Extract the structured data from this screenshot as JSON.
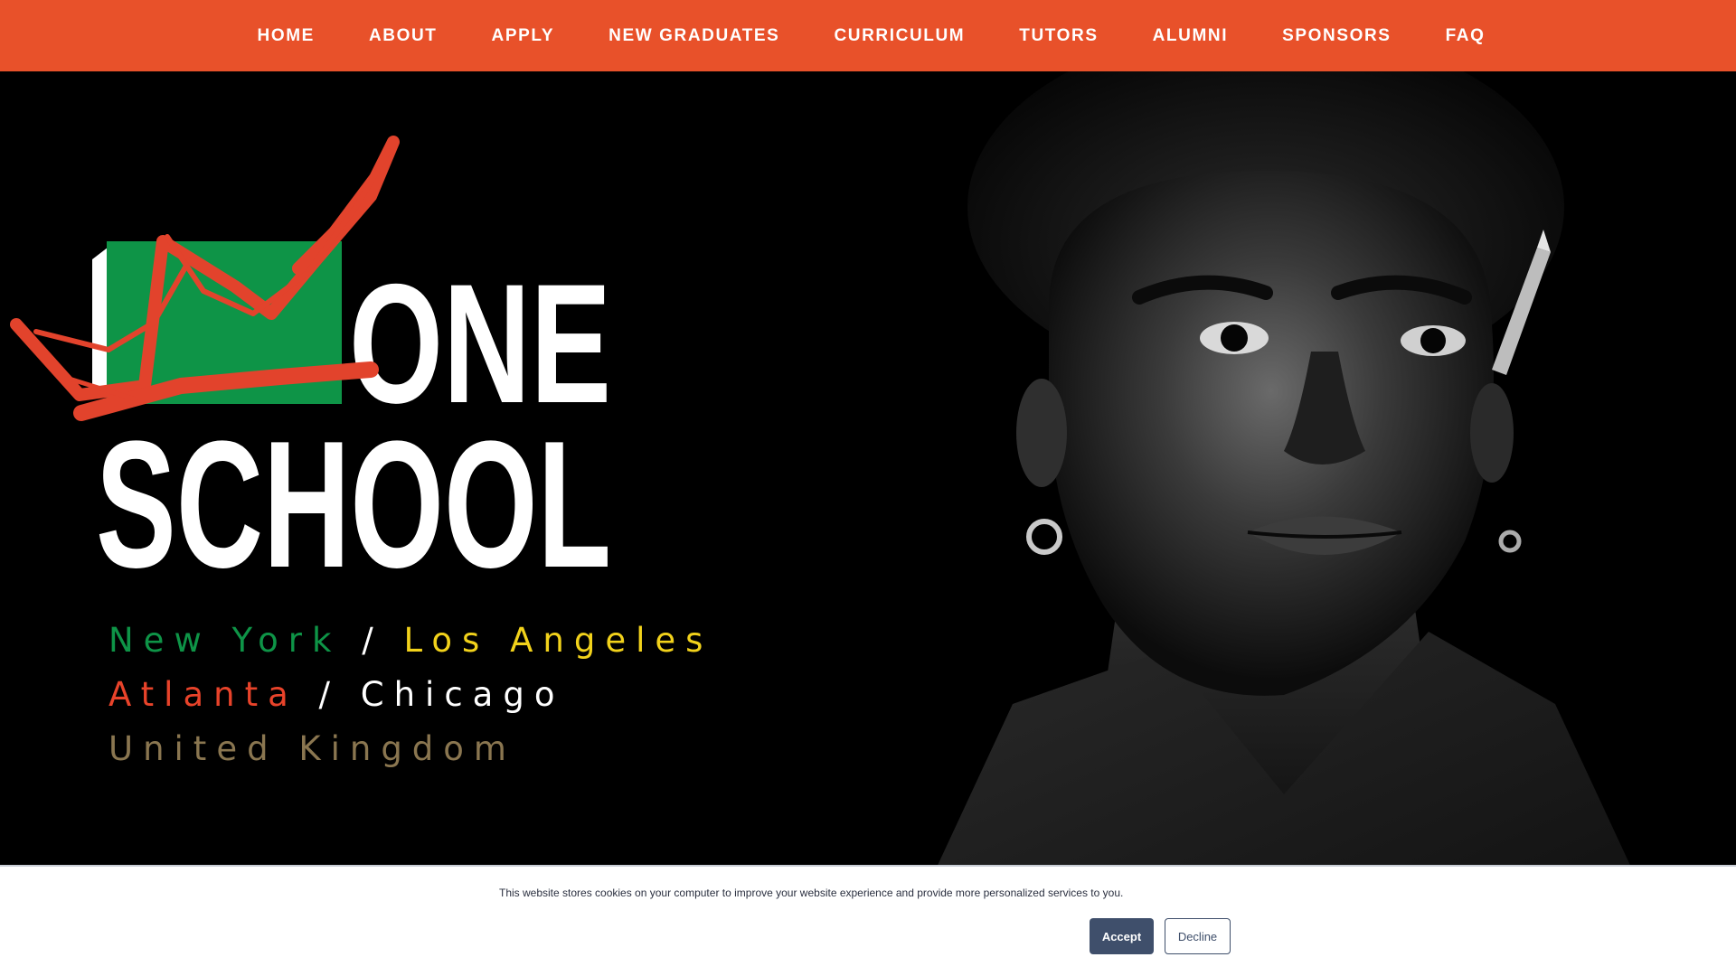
{
  "nav": {
    "items": [
      {
        "label": "HOME"
      },
      {
        "label": "ABOUT"
      },
      {
        "label": "APPLY"
      },
      {
        "label": "NEW GRADUATES"
      },
      {
        "label": "CURRICULUM"
      },
      {
        "label": "TUTORS"
      },
      {
        "label": "ALUMNI"
      },
      {
        "label": "SPONSORS"
      },
      {
        "label": "FAQ"
      }
    ]
  },
  "hero": {
    "logo": {
      "line1": "ONE",
      "line2": "SCHOOL"
    },
    "cities": {
      "new_york": "New York",
      "los_angeles": "Los Angeles",
      "atlanta": "Atlanta",
      "chicago": "Chicago",
      "uk": "United Kingdom",
      "separator": "/"
    },
    "portrait_icon": "portrait-photo"
  },
  "cookie": {
    "message": "This website stores cookies on your computer to improve your website experience and provide more personalized services to you.",
    "accept_label": "Accept",
    "decline_label": "Decline"
  },
  "colors": {
    "brand_orange": "#e8512a",
    "logo_green": "#0e9447",
    "crown_red": "#e2432c",
    "city_green": "#0e9447",
    "city_yellow": "#f2d21b",
    "city_red": "#e8432a",
    "city_white": "#ffffff",
    "city_gold": "#8a7650",
    "button_navy": "#3f4f6b"
  }
}
